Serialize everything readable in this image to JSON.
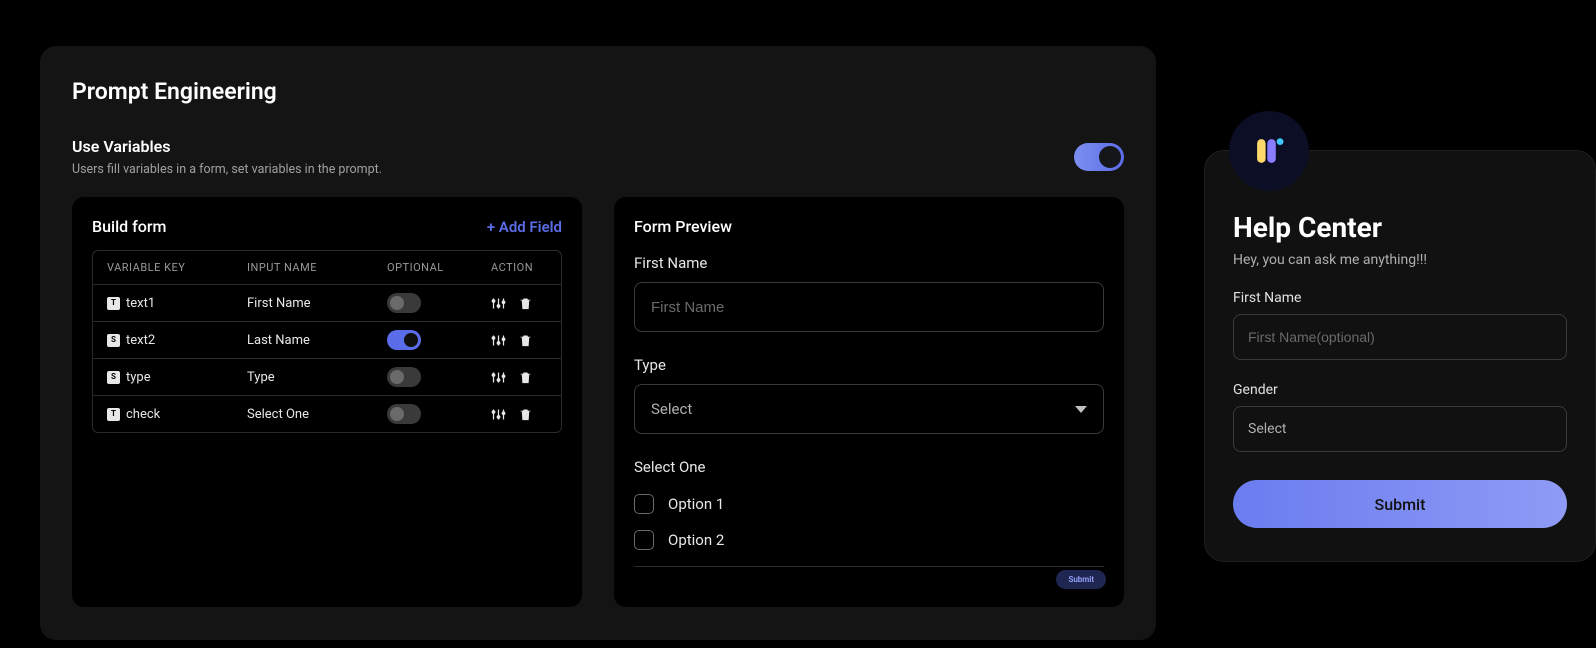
{
  "page": {
    "title": "Prompt Engineering",
    "vars_heading": "Use Variables",
    "vars_desc": "Users fill variables in a form, set variables in the prompt."
  },
  "build": {
    "title": "Build form",
    "add_field": "+ Add Field",
    "cols": {
      "variable_key": "VARIABLE KEY",
      "input_name": "INPUT NAME",
      "optional": "OPTIONAL",
      "action": "ACTION"
    },
    "rows": [
      {
        "badge": "T",
        "key": "text1",
        "name": "First Name",
        "optional": false
      },
      {
        "badge": "S",
        "key": "text2",
        "name": "Last Name",
        "optional": true
      },
      {
        "badge": "S",
        "key": "type",
        "name": "Type",
        "optional": false
      },
      {
        "badge": "T",
        "key": "check",
        "name": "Select One",
        "optional": false
      }
    ]
  },
  "preview": {
    "title": "Form Preview",
    "first_name_label": "First Name",
    "first_name_placeholder": "First Name",
    "type_label": "Type",
    "type_select": "Select",
    "select_one_label": "Select One",
    "options": [
      {
        "label": "Option 1"
      },
      {
        "label": "Option 2"
      }
    ],
    "submit": "Submit"
  },
  "help": {
    "title": "Help Center",
    "sub": "Hey, you can ask me anything!!!",
    "first_name_label": "First Name",
    "first_name_placeholder": "First Name(optional)",
    "gender_label": "Gender",
    "gender_select": "Select",
    "submit": "Submit"
  }
}
